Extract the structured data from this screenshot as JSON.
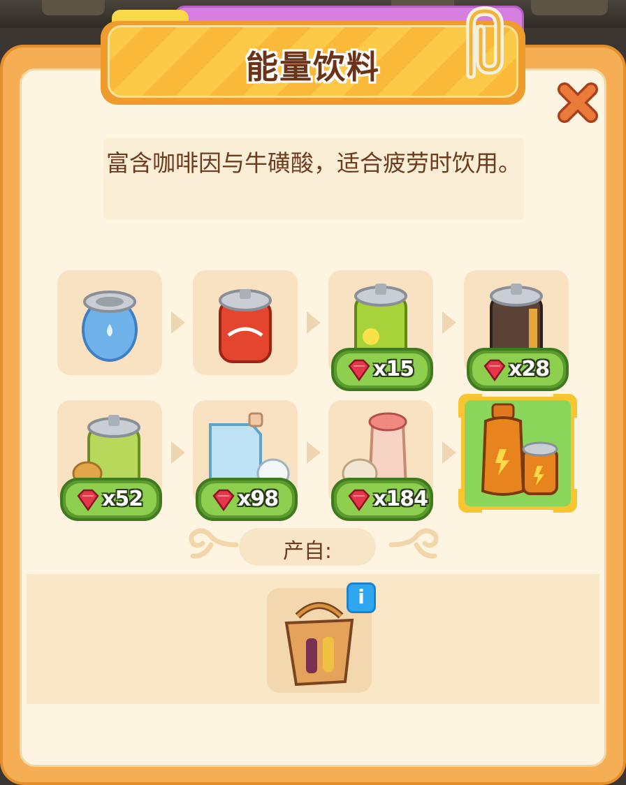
{
  "dialog": {
    "title": "能量饮料",
    "description": "富含咖啡因与牛磺酸，适合疲劳时饮用。",
    "source_label": "产自:"
  },
  "merge_chain": [
    {
      "name": "water-can",
      "cost": null
    },
    {
      "name": "cola-can",
      "cost": null
    },
    {
      "name": "lemon-soda-can",
      "cost": "x15"
    },
    {
      "name": "cola-zero-can",
      "cost": "x28"
    },
    {
      "name": "melon-soda-can",
      "cost": "x52"
    },
    {
      "name": "milk-carton",
      "cost": "x98"
    },
    {
      "name": "yakult-bottles",
      "cost": "x184"
    },
    {
      "name": "energy-drink",
      "cost": null,
      "selected": true
    }
  ],
  "source": {
    "name": "drink-carrier-bag",
    "info": "i"
  },
  "colors": {
    "panel": "#f6ae55",
    "panel_inner": "#fdf5e2",
    "banner": "#fcc948",
    "title_text": "#6b3418",
    "cost_badge": "#8fcf4f",
    "selected_frame": "#f6c531",
    "gem": "#e5364a"
  },
  "icons": {
    "close": "close-x-icon",
    "gem": "ruby-gem-icon",
    "info": "info-icon",
    "clip": "paperclip-icon"
  }
}
